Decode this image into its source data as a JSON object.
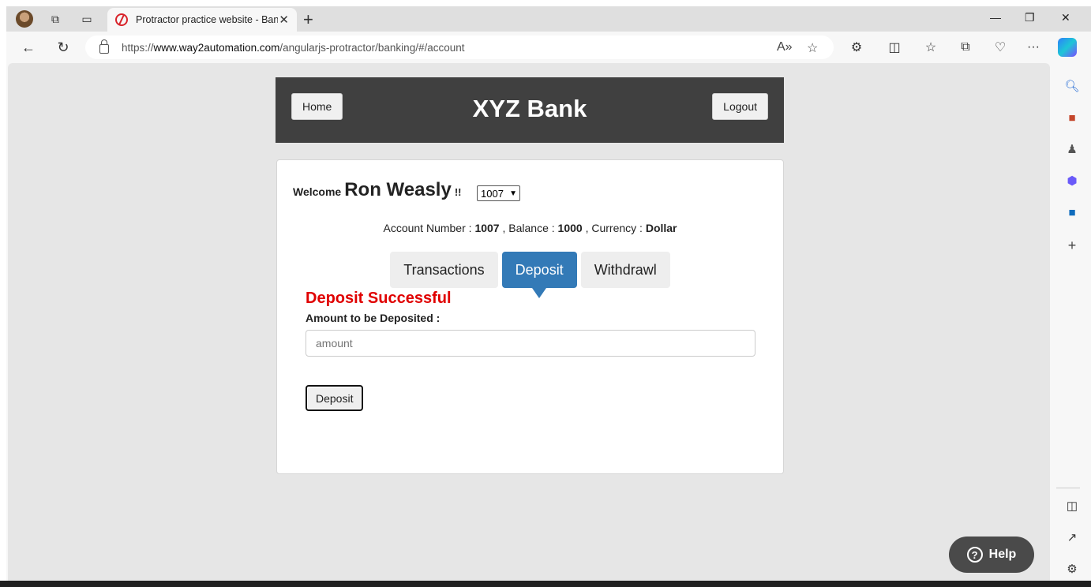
{
  "browser": {
    "tab_title": "Protractor practice website - Ban",
    "tab_close": "✕",
    "new_tab": "+",
    "url_prefix": "https://",
    "url_domain": "www.way2automation.com",
    "url_path": "/angularjs-protractor/banking/#/account",
    "window_controls": [
      "—",
      "❐",
      "✕"
    ],
    "menu": "···"
  },
  "bank": {
    "home_label": "Home",
    "title": "XYZ Bank",
    "logout_label": "Logout"
  },
  "account": {
    "welcome": "Welcome",
    "customer_name": "Ron Weasly",
    "exclaim": "!!",
    "selected_account": "1007",
    "account_number_label": "Account Number :",
    "account_number": "1007",
    "balance_label": ", Balance :",
    "balance": "1000",
    "currency_label": ", Currency :",
    "currency": "Dollar"
  },
  "tabs": [
    {
      "label": "Transactions",
      "active": false
    },
    {
      "label": "Deposit",
      "active": true
    },
    {
      "label": "Withdrawl",
      "active": false
    }
  ],
  "deposit_form": {
    "message": "Deposit Successful",
    "amount_label": "Amount to be Deposited :",
    "amount_placeholder": "amount",
    "amount_value": "",
    "submit_label": "Deposit"
  },
  "help": {
    "label": "Help",
    "icon": "?"
  },
  "colors": {
    "header_bg": "#404040",
    "active_tab": "#337ab7",
    "success_text": "#e00000"
  }
}
